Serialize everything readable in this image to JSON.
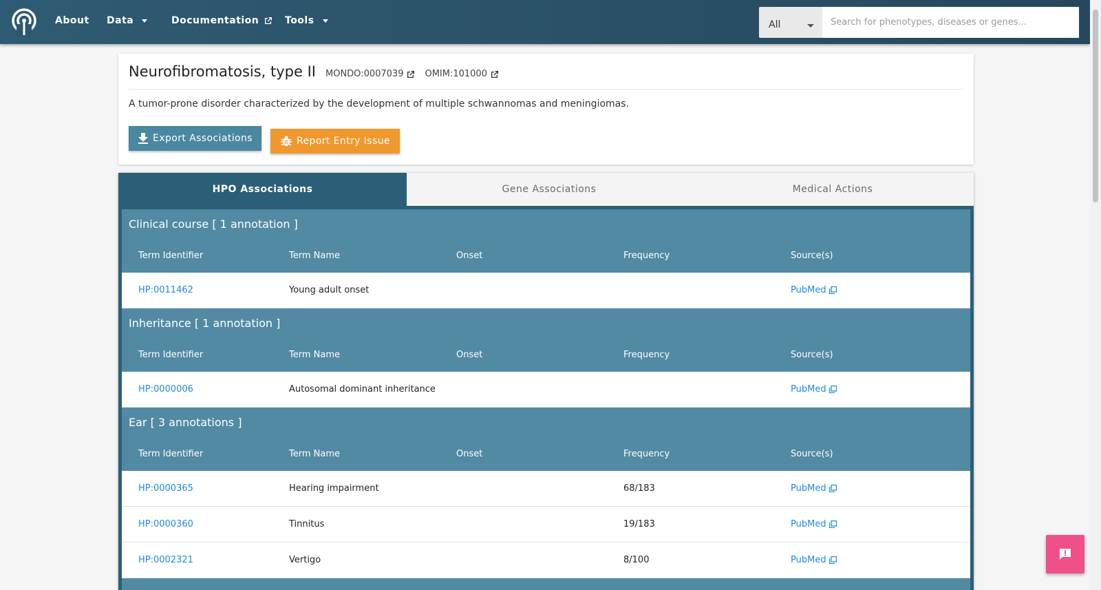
{
  "nav": {
    "items": [
      {
        "label": "About"
      },
      {
        "label": "Data"
      },
      {
        "label": "Documentation"
      },
      {
        "label": "Tools"
      }
    ],
    "search": {
      "category": "All",
      "placeholder": "Search for phenotypes, diseases or genes..."
    }
  },
  "disease": {
    "title": "Neurofibromatosis, type II",
    "xrefs": [
      {
        "label": "MONDO:0007039",
        "icon": "external-link-icon"
      },
      {
        "label": "OMIM:101000",
        "icon": "external-link-icon"
      }
    ],
    "description": "A tumor-prone disorder characterized by the development of multiple schwannomas and meningiomas.",
    "buttons": {
      "export": "Export Associations",
      "report": "Report Entry Issue"
    }
  },
  "tabs": [
    {
      "label": "HPO Associations",
      "active": true
    },
    {
      "label": "Gene Associations",
      "active": false
    },
    {
      "label": "Medical Actions",
      "active": false
    }
  ],
  "columns": [
    "Term Identifier",
    "Term Name",
    "Onset",
    "Frequency",
    "Source(s)"
  ],
  "sections": [
    {
      "title": "Clinical course [ 1 annotation ]",
      "rows": [
        {
          "id": "HP:0011462",
          "name": "Young adult onset",
          "onset": "",
          "frequency": "",
          "source": "PubMed"
        }
      ]
    },
    {
      "title": "Inheritance [ 1 annotation ]",
      "rows": [
        {
          "id": "HP:0000006",
          "name": "Autosomal dominant inheritance",
          "onset": "",
          "frequency": "",
          "source": "PubMed"
        }
      ]
    },
    {
      "title": "Ear [ 3 annotations ]",
      "rows": [
        {
          "id": "HP:0000365",
          "name": "Hearing impairment",
          "onset": "",
          "frequency": "68/183",
          "source": "PubMed"
        },
        {
          "id": "HP:0000360",
          "name": "Tinnitus",
          "onset": "",
          "frequency": "19/183",
          "source": "PubMed"
        },
        {
          "id": "HP:0002321",
          "name": "Vertigo",
          "onset": "",
          "frequency": "8/100",
          "source": "PubMed"
        }
      ]
    }
  ],
  "colors": {
    "navbar": "#2e5b73",
    "section_header": "#528aa3",
    "tab_active": "#2b5f78",
    "export_button": "#4a87a0",
    "report_button": "#f0982d",
    "feedback_button": "#f0508a",
    "link": "#1e88e5"
  }
}
